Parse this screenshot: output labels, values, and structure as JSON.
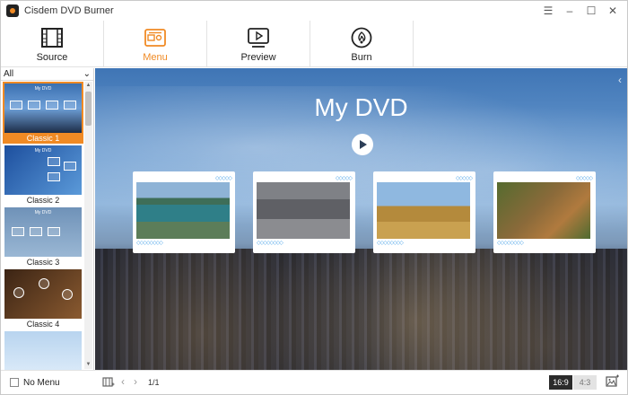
{
  "app": {
    "title": "Cisdem DVD Burner"
  },
  "window_controls": [
    "menu-icon",
    "minimize-icon",
    "maximize-icon",
    "close-icon"
  ],
  "topnav": {
    "tabs": [
      {
        "label": "Source",
        "icon": "film-icon",
        "active": false
      },
      {
        "label": "Menu",
        "icon": "menu-template-icon",
        "active": true
      },
      {
        "label": "Preview",
        "icon": "play-screen-icon",
        "active": false
      },
      {
        "label": "Burn",
        "icon": "disc-burn-icon",
        "active": false
      }
    ]
  },
  "colors": {
    "accent": "#f08a24",
    "active_ratio": "#2b2b2b"
  },
  "sidebar": {
    "filter": "All",
    "templates": [
      {
        "label": "Classic 1",
        "selected": true
      },
      {
        "label": "Classic 2",
        "selected": false
      },
      {
        "label": "Classic 3",
        "selected": false
      },
      {
        "label": "Classic 4",
        "selected": false
      },
      {
        "label": "",
        "selected": false
      }
    ]
  },
  "preview": {
    "title": "My DVD",
    "card_dots": "◇◇◇◇◇◇◇◇",
    "card_dots_top": "◇◇◇◇◇"
  },
  "bottombar": {
    "no_menu_label": "No Menu",
    "page": "1/1",
    "ratio_169": "16:9",
    "ratio_43": "4:3"
  }
}
